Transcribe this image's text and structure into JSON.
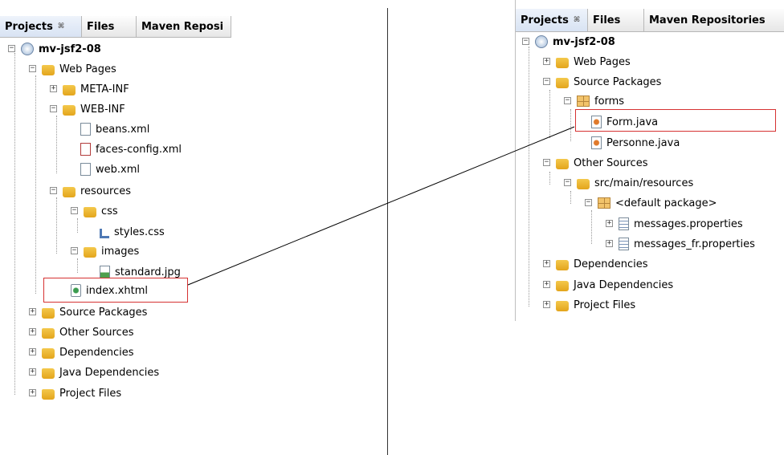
{
  "left_panel": {
    "tabs": [
      {
        "label": "Projects",
        "close": "⌘"
      },
      {
        "label": "Files"
      },
      {
        "label": "Maven Reposi"
      }
    ],
    "tree": [
      {
        "label": "mv-jsf2-08",
        "bold": true,
        "icon": "maven-project-icon"
      },
      {
        "label": "Web Pages",
        "icon": "web-pages-folder-icon"
      },
      {
        "label": "META-INF",
        "icon": "folder-icon"
      },
      {
        "label": "WEB-INF",
        "icon": "folder-icon"
      },
      {
        "label": "beans.xml",
        "icon": "xml-file-icon"
      },
      {
        "label": "faces-config.xml",
        "icon": "jsf-config-file-icon"
      },
      {
        "label": "web.xml",
        "icon": "web-xml-file-icon"
      },
      {
        "label": "resources",
        "icon": "folder-icon"
      },
      {
        "label": "css",
        "icon": "folder-icon"
      },
      {
        "label": "styles.css",
        "icon": "css-file-icon"
      },
      {
        "label": "images",
        "icon": "folder-icon"
      },
      {
        "label": "standard.jpg",
        "icon": "image-file-icon"
      },
      {
        "label": "index.xhtml",
        "icon": "xhtml-file-icon"
      },
      {
        "label": "Source Packages",
        "icon": "source-packages-icon"
      },
      {
        "label": "Other Sources",
        "icon": "other-sources-icon"
      },
      {
        "label": "Dependencies",
        "icon": "dependencies-icon"
      },
      {
        "label": "Java Dependencies",
        "icon": "java-dependencies-icon"
      },
      {
        "label": "Project Files",
        "icon": "project-files-icon"
      }
    ]
  },
  "right_panel": {
    "tabs": [
      {
        "label": "Projects",
        "close": "⌘"
      },
      {
        "label": "Files"
      },
      {
        "label": "Maven Repositories"
      }
    ],
    "tree": [
      {
        "label": "mv-jsf2-08",
        "bold": true,
        "icon": "maven-project-icon"
      },
      {
        "label": "Web Pages",
        "icon": "web-pages-folder-icon"
      },
      {
        "label": "Source Packages",
        "icon": "source-packages-icon"
      },
      {
        "label": "forms",
        "icon": "package-icon"
      },
      {
        "label": "Form.java",
        "icon": "java-class-icon"
      },
      {
        "label": "Personne.java",
        "icon": "java-class-icon"
      },
      {
        "label": "Other Sources",
        "icon": "other-sources-icon"
      },
      {
        "label": "src/main/resources",
        "icon": "other-sources-icon"
      },
      {
        "label": "<default package>",
        "icon": "package-icon"
      },
      {
        "label": "messages.properties",
        "icon": "properties-file-icon"
      },
      {
        "label": "messages_fr.properties",
        "icon": "properties-file-icon"
      },
      {
        "label": "Dependencies",
        "icon": "dependencies-icon"
      },
      {
        "label": "Java Dependencies",
        "icon": "java-dependencies-icon"
      },
      {
        "label": "Project Files",
        "icon": "project-files-icon"
      }
    ]
  },
  "colors": {
    "highlight": "#d63232",
    "folder": "#e3a51c",
    "connector": "#000000"
  }
}
